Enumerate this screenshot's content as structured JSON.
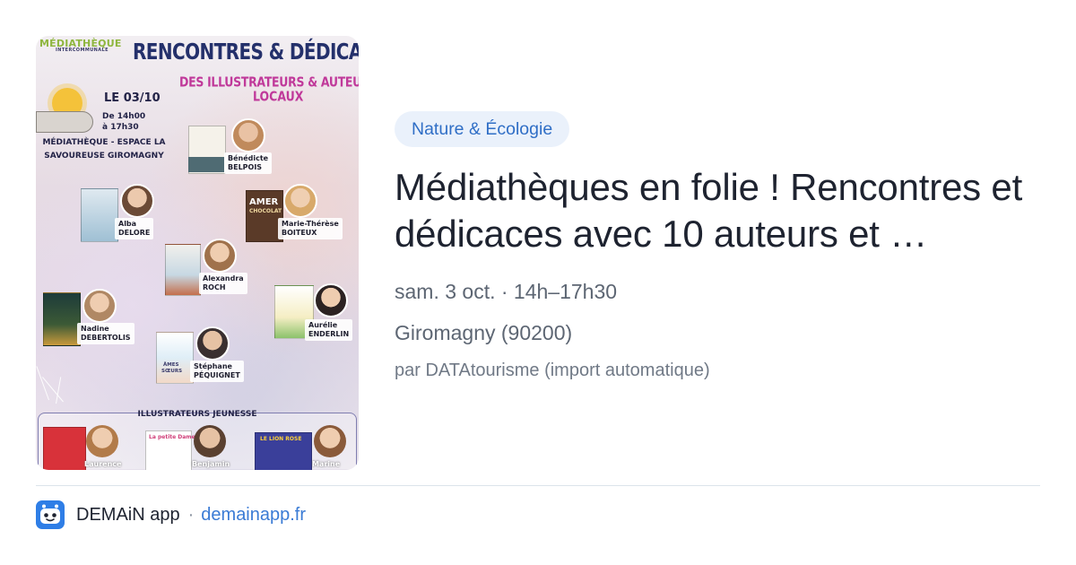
{
  "poster": {
    "logo": "MÉDIATHÈQUE",
    "logo_sub": "INTERCOMMUNALE",
    "title": "RENCONTRES & DÉDICACES",
    "subtitle_line1": "DES ILLUSTRATEURS & AUTEURS",
    "subtitle_line2": "LOCAUX",
    "date": "LE 03/10",
    "time_line1": "De 14h00",
    "time_line2": "à 17h30",
    "place_line1": "MÉDIATHÈQUE - ESPACE LA",
    "place_line2": "SAVOUREUSE GIROMAGNY",
    "authors": [
      {
        "first": "Bénédicte",
        "last": "BELPOIS"
      },
      {
        "first": "Alba",
        "last": "DELORE"
      },
      {
        "first": "Marie-Thérèse",
        "last": "BOITEUX"
      },
      {
        "first": "Alexandra",
        "last": "ROCH"
      },
      {
        "first": "Aurélie",
        "last": "ENDERLIN"
      },
      {
        "first": "Nadine",
        "last": "DEBERTOLIS"
      },
      {
        "first": "Stéphane",
        "last": "PÉQUIGNET"
      }
    ],
    "illustrators_title": "ILLUSTRATEURS JEUNESSE",
    "illustrators": [
      "Laurence",
      "Benjamin",
      "Marine"
    ],
    "book_texts": {
      "amer": "AMER",
      "chocolat": "CHOCOLAT",
      "ames": "ÂMES",
      "soeurs": "SŒURS",
      "petite_dame": "La petite Dame",
      "lion": "LE LION ROSE"
    }
  },
  "event": {
    "category": "Nature & Écologie",
    "title": "Médiathèques en folie ! Rencontres et dédicaces avec 10 auteurs et …",
    "date_time": "sam. 3 oct. · 14h–17h30",
    "location": "Giromagny (90200)",
    "source": "par DATAtourisme (import automatique)"
  },
  "footer": {
    "app_name": "DEMAiN app",
    "separator": "·",
    "domain": "demainapp.fr",
    "icon": "demain-app-icon"
  },
  "colors": {
    "chip_bg": "#eaf1fb",
    "chip_text": "#2f6ec6",
    "title_text": "#1e2330",
    "meta_text": "#5d6673",
    "link": "#3a7bd5",
    "divider": "#dce3ea"
  }
}
